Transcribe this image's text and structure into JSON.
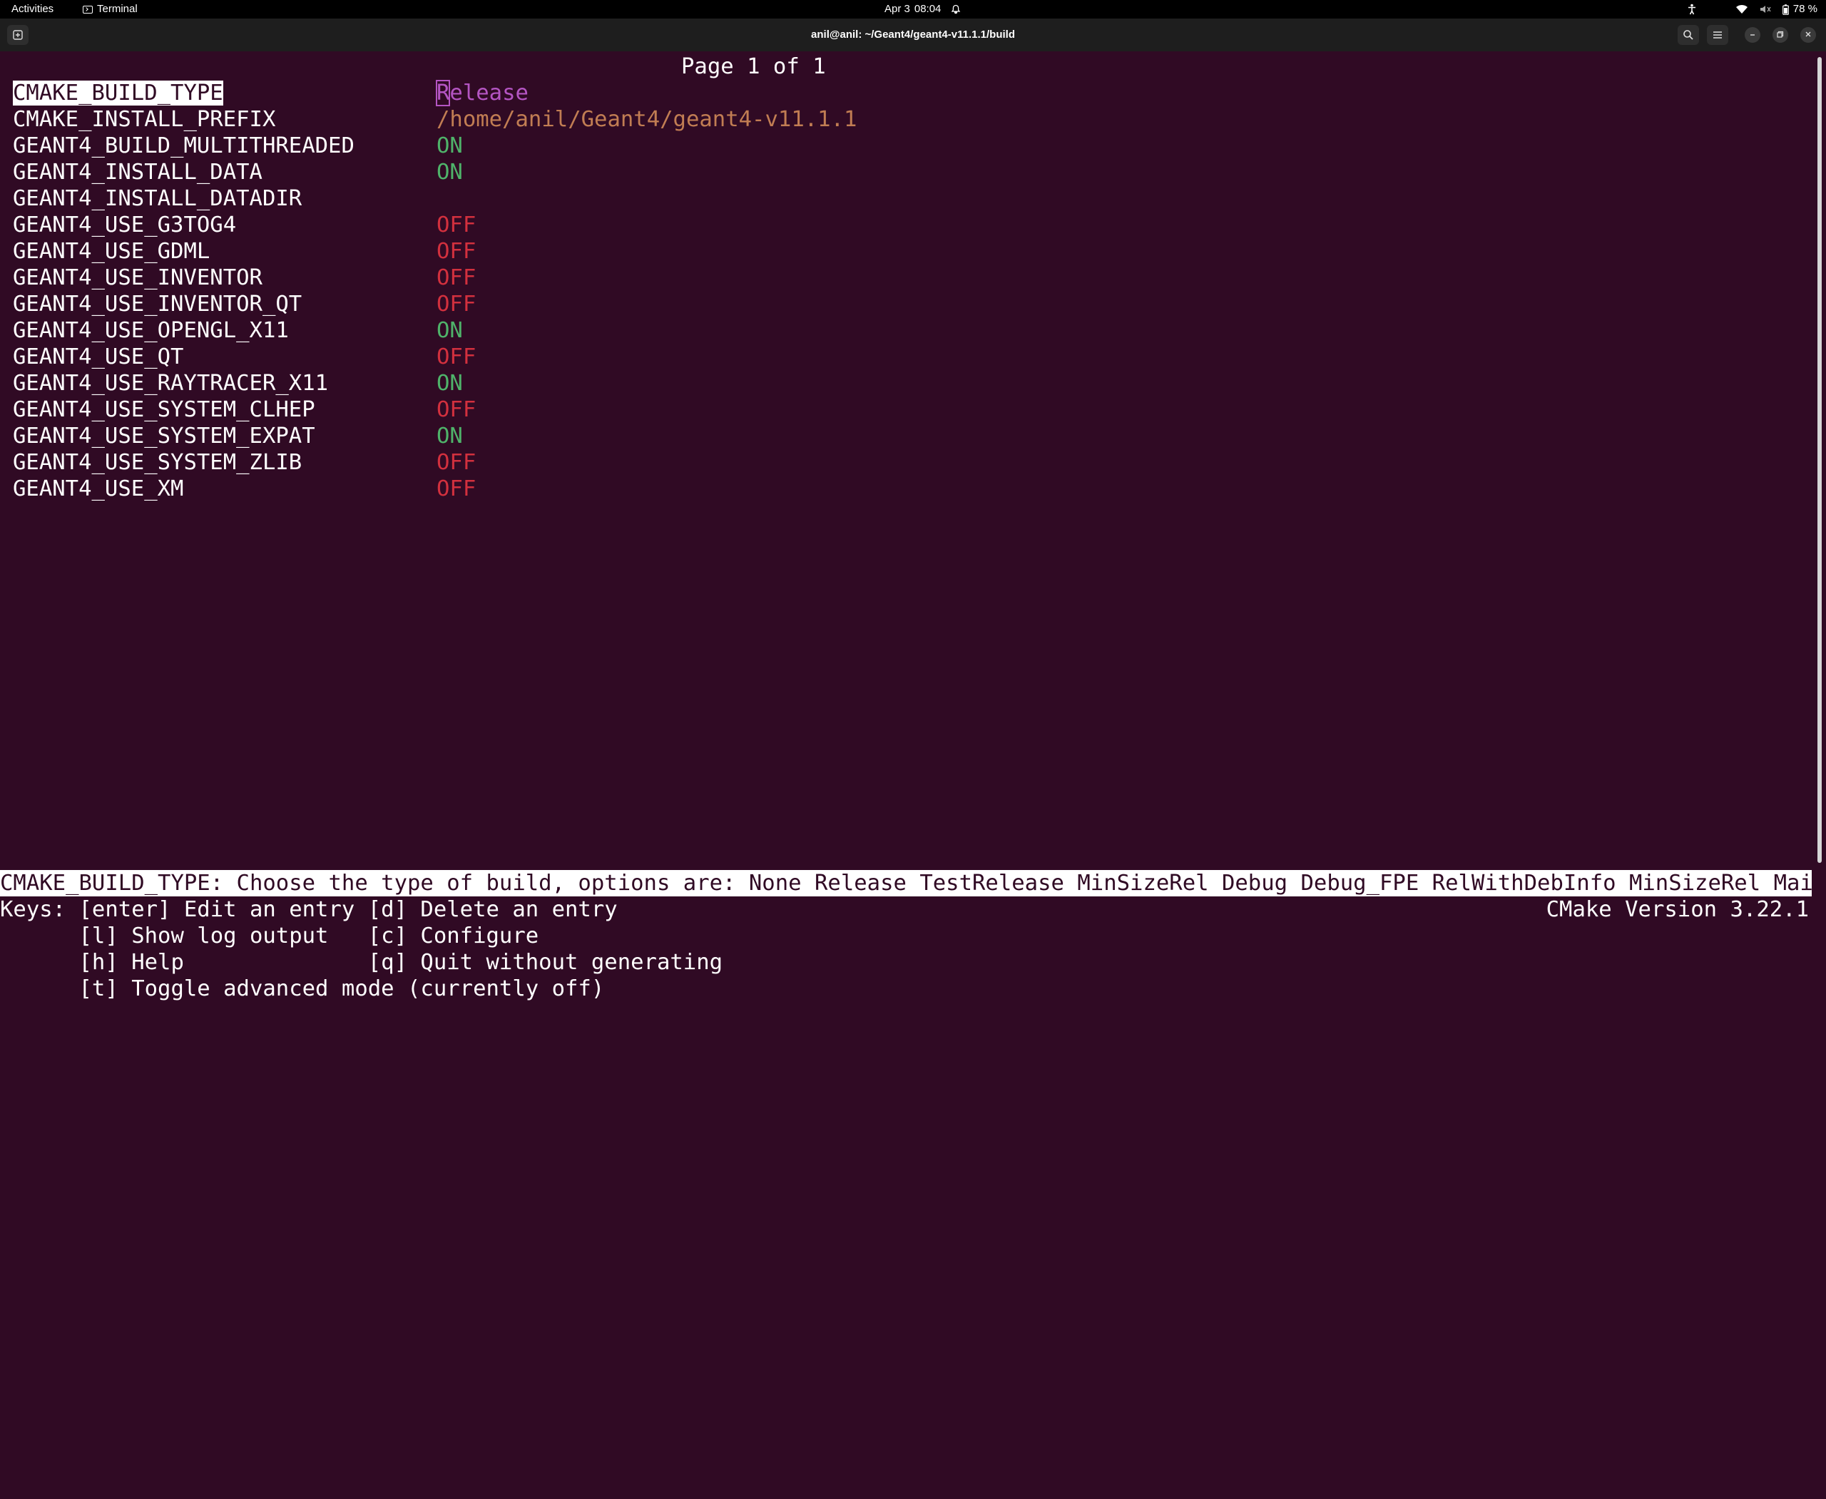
{
  "topbar": {
    "activities": "Activities",
    "app_name": "Terminal",
    "date": "Apr 3",
    "time": "08:04",
    "battery": "78 %"
  },
  "window": {
    "title": "anil@anil: ~/Geant4/geant4-v11.1.1/build"
  },
  "ccmake": {
    "page_indicator": "Page 1 of 1",
    "entries": [
      {
        "key": "CMAKE_BUILD_TYPE",
        "value": "Release",
        "kind": "enum",
        "selected": true
      },
      {
        "key": "CMAKE_INSTALL_PREFIX",
        "value": "/home/anil/Geant4/geant4-v11.1.1",
        "kind": "string"
      },
      {
        "key": "GEANT4_BUILD_MULTITHREADED",
        "value": "ON",
        "kind": "on"
      },
      {
        "key": "GEANT4_INSTALL_DATA",
        "value": "ON",
        "kind": "on"
      },
      {
        "key": "GEANT4_INSTALL_DATADIR",
        "value": "",
        "kind": "string"
      },
      {
        "key": "GEANT4_USE_G3TOG4",
        "value": "OFF",
        "kind": "off"
      },
      {
        "key": "GEANT4_USE_GDML",
        "value": "OFF",
        "kind": "off"
      },
      {
        "key": "GEANT4_USE_INVENTOR",
        "value": "OFF",
        "kind": "off"
      },
      {
        "key": "GEANT4_USE_INVENTOR_QT",
        "value": "OFF",
        "kind": "off"
      },
      {
        "key": "GEANT4_USE_OPENGL_X11",
        "value": "ON",
        "kind": "on"
      },
      {
        "key": "GEANT4_USE_QT",
        "value": "OFF",
        "kind": "off"
      },
      {
        "key": "GEANT4_USE_RAYTRACER_X11",
        "value": "ON",
        "kind": "on"
      },
      {
        "key": "GEANT4_USE_SYSTEM_CLHEP",
        "value": "OFF",
        "kind": "off"
      },
      {
        "key": "GEANT4_USE_SYSTEM_EXPAT",
        "value": "ON",
        "kind": "on"
      },
      {
        "key": "GEANT4_USE_SYSTEM_ZLIB",
        "value": "OFF",
        "kind": "off"
      },
      {
        "key": "GEANT4_USE_XM",
        "value": "OFF",
        "kind": "off"
      }
    ],
    "status_line": "CMAKE_BUILD_TYPE: Choose the type of build, options are: None Release TestRelease MinSizeRel Debug Debug_FPE RelWithDebInfo MinSizeRel Mainta",
    "keys": [
      "Keys: [enter] Edit an entry [d] Delete an entry",
      "      [l] Show log output   [c] Configure",
      "      [h] Help              [q] Quit without generating",
      "      [t] Toggle advanced mode (currently off)"
    ],
    "cmake_version": "CMake Version 3.22.1"
  },
  "colors": {
    "terminal_bg": "#300a24",
    "on": "#4fb36a",
    "off": "#d2303e",
    "path": "#c17d53",
    "enum": "#b455c3"
  }
}
